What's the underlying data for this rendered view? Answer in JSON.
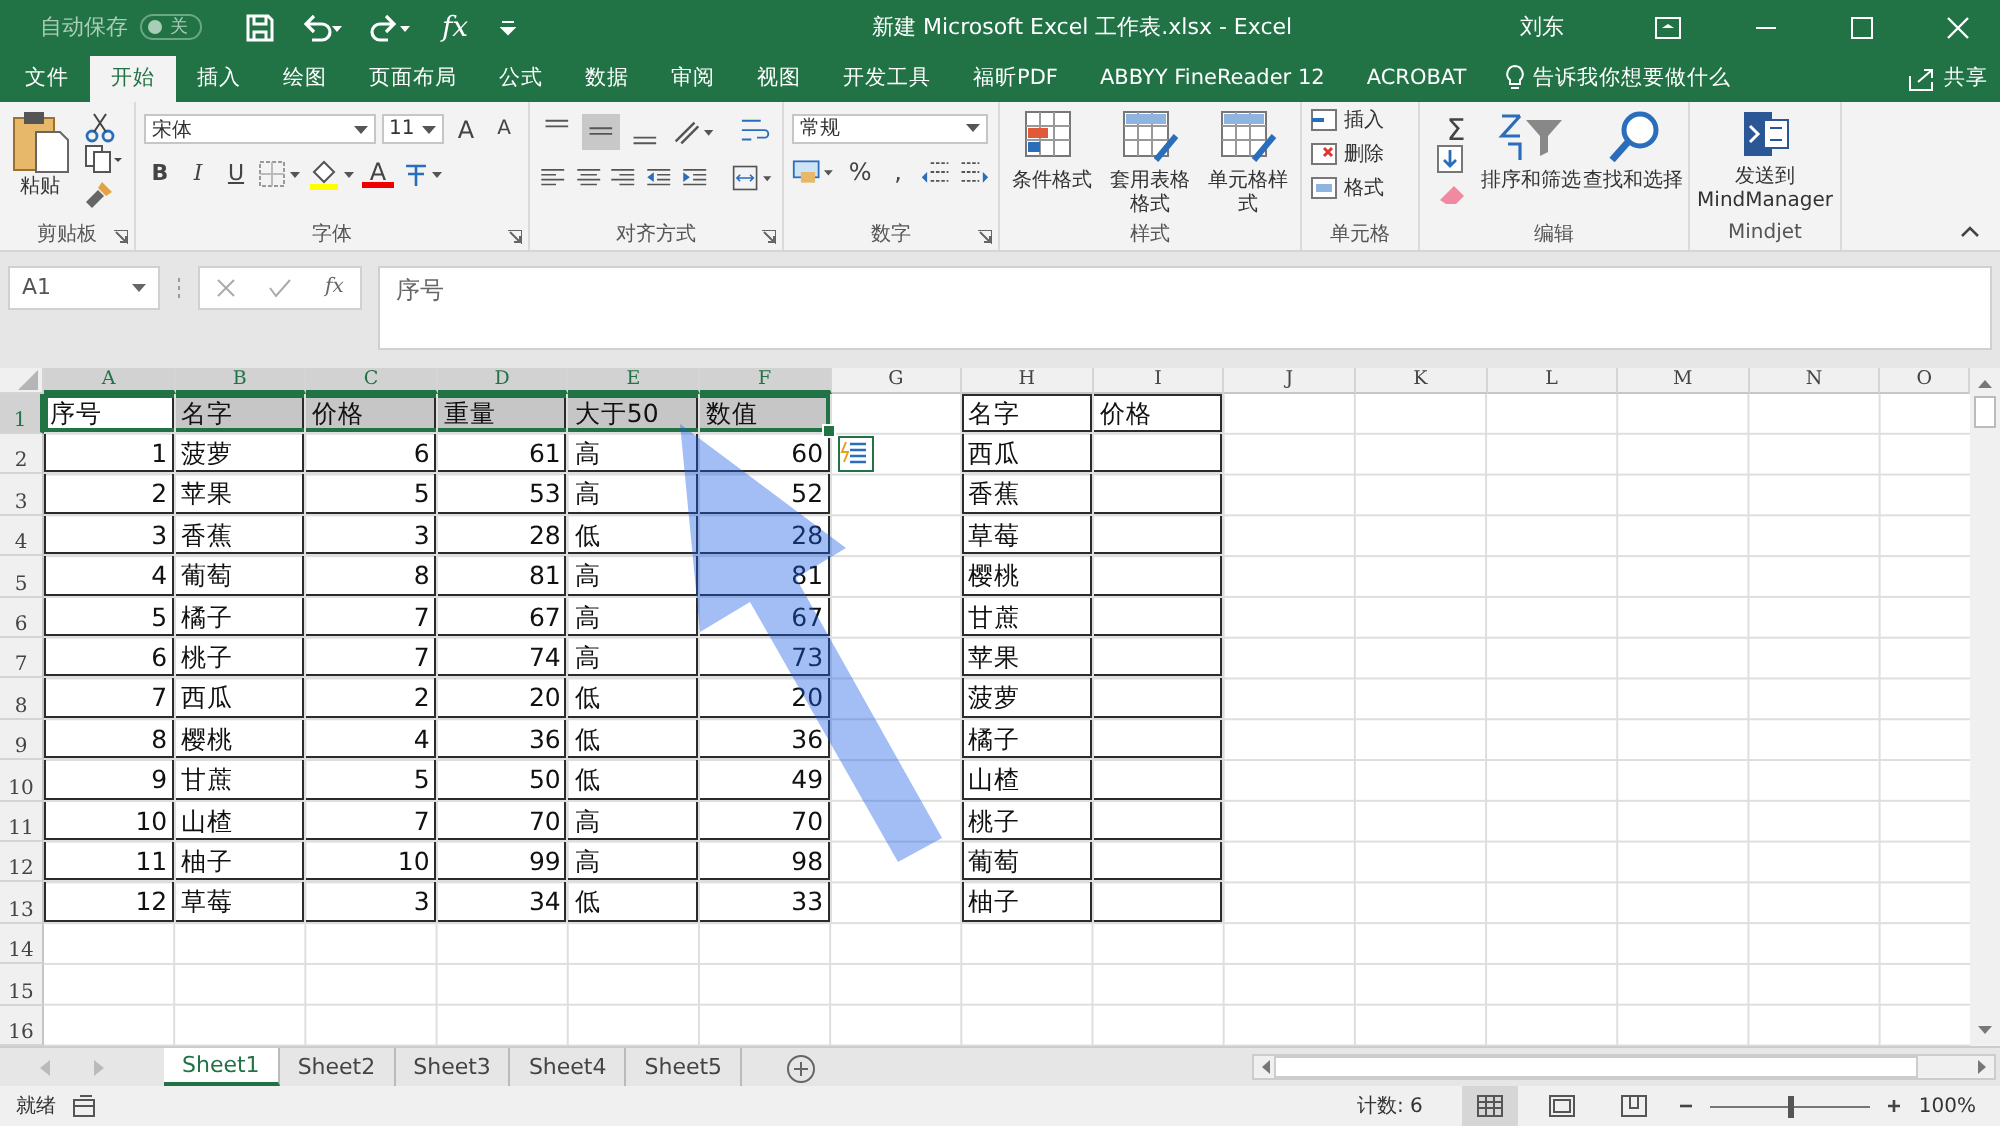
{
  "title_bar": {
    "autosave_label": "自动保存",
    "autosave_state": "关",
    "autosave_on": false,
    "formula_label": "fx",
    "title": "新建 Microsoft Excel 工作表.xlsx  -  Excel",
    "user": "刘东"
  },
  "tabs": [
    {
      "label": "文件",
      "selected": false
    },
    {
      "label": "开始",
      "selected": true
    },
    {
      "label": "插入",
      "selected": false
    },
    {
      "label": "绘图",
      "selected": false
    },
    {
      "label": "页面布局",
      "selected": false
    },
    {
      "label": "公式",
      "selected": false
    },
    {
      "label": "数据",
      "selected": false
    },
    {
      "label": "审阅",
      "selected": false
    },
    {
      "label": "视图",
      "selected": false
    },
    {
      "label": "开发工具",
      "selected": false
    },
    {
      "label": "福昕PDF",
      "selected": false
    },
    {
      "label": "ABBYY FineReader 12",
      "selected": false
    },
    {
      "label": "ACROBAT",
      "selected": false
    }
  ],
  "tell_me": "告诉我你想要做什么",
  "share": "共享",
  "ribbon": {
    "clipboard": {
      "paste": "粘贴",
      "label": "剪贴板"
    },
    "font": {
      "name": "宋体",
      "size": "11",
      "grow": "A",
      "shrink": "A",
      "styles": [
        "B",
        "I",
        "U"
      ],
      "color_button": "A",
      "label": "字体"
    },
    "alignment": {
      "vertical": [
        {
          "kind": "top",
          "selected": false
        },
        {
          "kind": "middle",
          "selected": true
        },
        {
          "kind": "bottom",
          "selected": false
        }
      ],
      "label": "对齐方式"
    },
    "number": {
      "format": "常规",
      "percent": "%",
      "comma": ",",
      "label": "数字"
    },
    "styles": {
      "buttons": [
        "条件格式",
        "套用表格格式",
        "单元格样式"
      ],
      "label": "样式"
    },
    "cells": {
      "buttons": [
        "插入",
        "删除",
        "格式"
      ],
      "label": "单元格"
    },
    "editing": {
      "autosum": "Σ",
      "buttons": [
        "排序和筛选",
        "查找和选择"
      ],
      "label": "编辑"
    },
    "mindjet": {
      "button": "发送到\nMindManager",
      "label": "Mindjet"
    }
  },
  "formula_bar": {
    "name_box": "A1",
    "fx": "fx",
    "content": "序号"
  },
  "column_headers": [
    {
      "label": "A",
      "selected": true
    },
    {
      "label": "B",
      "selected": true
    },
    {
      "label": "C",
      "selected": true
    },
    {
      "label": "D",
      "selected": true
    },
    {
      "label": "E",
      "selected": true
    },
    {
      "label": "F",
      "selected": true
    },
    {
      "label": "G",
      "selected": false
    },
    {
      "label": "H",
      "selected": false
    },
    {
      "label": "I",
      "selected": false
    },
    {
      "label": "J",
      "selected": false
    },
    {
      "label": "K",
      "selected": false
    },
    {
      "label": "L",
      "selected": false
    },
    {
      "label": "M",
      "selected": false
    },
    {
      "label": "N",
      "selected": false
    },
    {
      "label": "O",
      "selected": false
    }
  ],
  "row_headers": [
    {
      "label": "1",
      "selected": true
    },
    {
      "label": "2",
      "selected": false
    },
    {
      "label": "3",
      "selected": false
    },
    {
      "label": "4",
      "selected": false
    },
    {
      "label": "5",
      "selected": false
    },
    {
      "label": "6",
      "selected": false
    },
    {
      "label": "7",
      "selected": false
    },
    {
      "label": "8",
      "selected": false
    },
    {
      "label": "9",
      "selected": false
    },
    {
      "label": "10",
      "selected": false
    },
    {
      "label": "11",
      "selected": false
    },
    {
      "label": "12",
      "selected": false
    },
    {
      "label": "13",
      "selected": false
    },
    {
      "label": "14",
      "selected": false
    },
    {
      "label": "15",
      "selected": false
    },
    {
      "label": "16",
      "selected": false
    }
  ],
  "table_1": {
    "header_selected": true,
    "columns": [
      {
        "label": "序号",
        "kind": "number"
      },
      {
        "label": "名字",
        "kind": "text"
      },
      {
        "label": "价格",
        "kind": "number"
      },
      {
        "label": "重量",
        "kind": "number"
      },
      {
        "label": "大于50",
        "kind": "text"
      },
      {
        "label": "数值",
        "kind": "number"
      }
    ],
    "rows": [
      [
        "1",
        "菠萝",
        "6",
        "61",
        "高",
        "60"
      ],
      [
        "2",
        "苹果",
        "5",
        "53",
        "高",
        "52"
      ],
      [
        "3",
        "香蕉",
        "3",
        "28",
        "低",
        "28"
      ],
      [
        "4",
        "葡萄",
        "8",
        "81",
        "高",
        "81"
      ],
      [
        "5",
        "橘子",
        "7",
        "67",
        "高",
        "67"
      ],
      [
        "6",
        "桃子",
        "7",
        "74",
        "高",
        "73"
      ],
      [
        "7",
        "西瓜",
        "2",
        "20",
        "低",
        "20"
      ],
      [
        "8",
        "樱桃",
        "4",
        "36",
        "低",
        "36"
      ],
      [
        "9",
        "甘蔗",
        "5",
        "50",
        "低",
        "49"
      ],
      [
        "10",
        "山楂",
        "7",
        "70",
        "高",
        "70"
      ],
      [
        "11",
        "柚子",
        "10",
        "99",
        "高",
        "98"
      ],
      [
        "12",
        "草莓",
        "3",
        "34",
        "低",
        "33"
      ]
    ]
  },
  "table_2": {
    "columns": [
      "名字",
      "价格"
    ],
    "rows": [
      "西瓜",
      "香蕉",
      "草莓",
      "樱桃",
      "甘蔗",
      "苹果",
      "菠萝",
      "橘子",
      "山楂",
      "桃子",
      "葡萄",
      "柚子"
    ]
  },
  "sheet_tabs": [
    {
      "label": "Sheet1",
      "selected": true
    },
    {
      "label": "Sheet2",
      "selected": false
    },
    {
      "label": "Sheet3",
      "selected": false
    },
    {
      "label": "Sheet4",
      "selected": false
    },
    {
      "label": "Sheet5",
      "selected": false
    }
  ],
  "status_bar": {
    "state": "就绪",
    "count": "计数: 6",
    "views": [
      {
        "kind": "normal",
        "selected": true
      },
      {
        "kind": "page-layout",
        "selected": false
      },
      {
        "kind": "page-break",
        "selected": false
      }
    ],
    "zoom_slider": {
      "level": 0.5
    },
    "zoom": "100%"
  }
}
